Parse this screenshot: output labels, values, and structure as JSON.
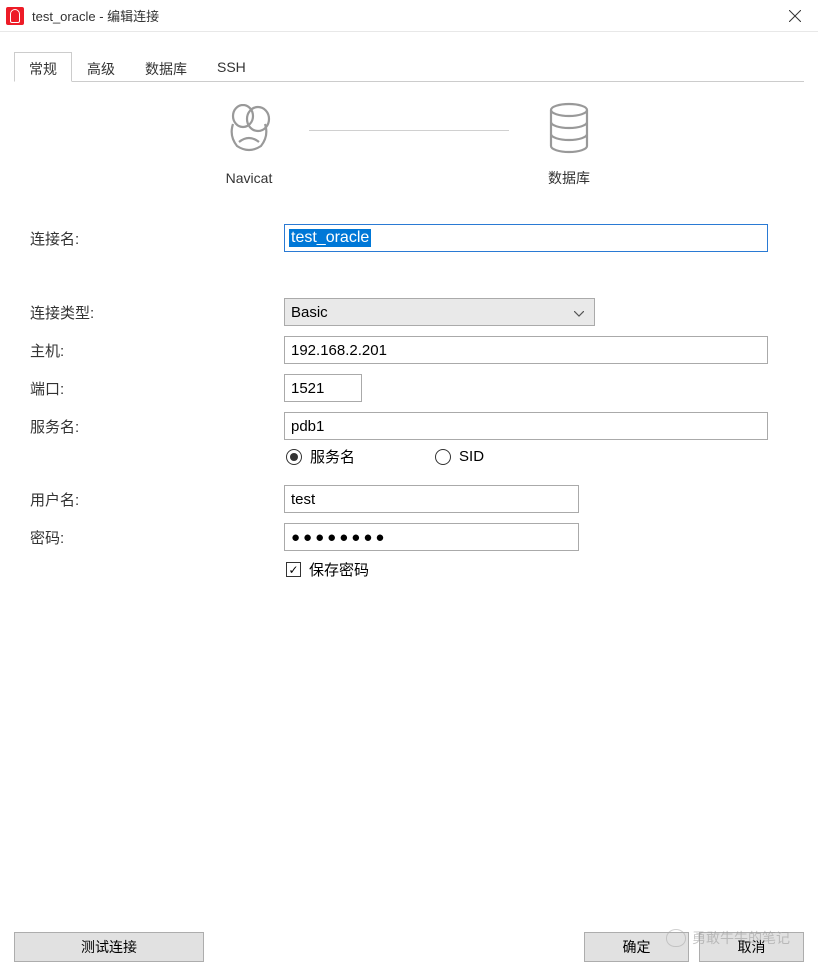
{
  "window_title": "test_oracle - 编辑连接",
  "tabs": [
    "常规",
    "高级",
    "数据库",
    "SSH"
  ],
  "active_tab_index": 0,
  "header": {
    "left_label": "Navicat",
    "right_label": "数据库"
  },
  "labels": {
    "connection_name": "连接名:",
    "connection_type": "连接类型:",
    "host": "主机:",
    "port": "端口:",
    "service_name": "服务名:",
    "username": "用户名:",
    "password": "密码:",
    "save_password": "保存密码"
  },
  "values": {
    "connection_name": "test_oracle",
    "connection_type": "Basic",
    "host": "192.168.2.201",
    "port": "1521",
    "service_name": "pdb1",
    "username": "test",
    "password": "●●●●●●●●"
  },
  "radio": {
    "service_name": "服务名",
    "sid": "SID",
    "selected": "service_name"
  },
  "save_password_checked": true,
  "footer": {
    "test": "测试连接",
    "ok": "确定",
    "cancel": "取消"
  },
  "watermark": "勇敢牛牛的笔记"
}
